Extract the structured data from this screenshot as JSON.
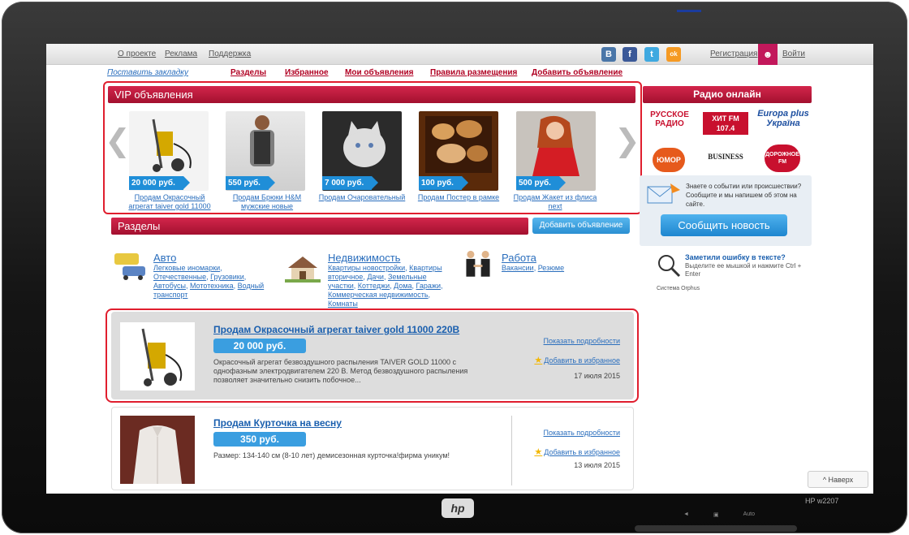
{
  "topbar": {
    "links": [
      "О проекте",
      "Реклама",
      "Поддержка"
    ],
    "social": [
      "В",
      "f",
      "t",
      "ok"
    ],
    "register": "Регистрация",
    "login": "Войти"
  },
  "nav": {
    "bookmark": "Поставить закладку",
    "links": [
      "Разделы",
      "Избранное",
      "Мои объявления",
      "Правила размещения",
      "Добавить объявление"
    ]
  },
  "vip": {
    "title": "VIP объявления",
    "items": [
      {
        "price": "20 000 руб.",
        "title": "Продам Окрасочный агрегат taiver gold 11000"
      },
      {
        "price": "550 руб.",
        "title": "Продам Брюки H&M мужские новые"
      },
      {
        "price": "7 000 руб.",
        "title": "Продам Очаровательный"
      },
      {
        "price": "100 руб.",
        "title": "Продам Постер в рамке"
      },
      {
        "price": "500 руб.",
        "title": "Продам Жакет из флиса next"
      }
    ]
  },
  "sections": {
    "title": "Разделы",
    "add_button": "Добавить объявление",
    "categories": [
      {
        "title": "Авто",
        "links": [
          "Легковые иномарки",
          "Отечественные",
          "Грузовики",
          "Автобусы",
          "Мототехника",
          "Водный транспорт"
        ]
      },
      {
        "title": "Недвижимость",
        "links": [
          "Квартиры новостройки",
          "Квартиры вторичное",
          "Дачи",
          "Земельные участки",
          "Коттеджи",
          "Дома",
          "Гаражи",
          "Коммерческая недвижимость",
          "Комнаты"
        ]
      },
      {
        "title": "Работа",
        "links": [
          "Вакансии",
          "Резюме"
        ]
      }
    ]
  },
  "listings": [
    {
      "title": "Продам Окрасочный агрегат taiver gold 11000 220В",
      "price": "20 000 руб.",
      "description": "Окрасочный агрегат безвоздушного распыления TAIVER GOLD 11000 с однофазным электродвигателем 220 В. Метод безвоздушного распыления позволяет значительно снизить побочное...",
      "more": "Показать подробности",
      "favorite": "Добавить в избранное",
      "date": "17 июля 2015"
    },
    {
      "title": "Продам Курточка на весну",
      "price": "350 руб.",
      "description": "Размер: 134-140 см (8-10 лет) демисезонная курточка!фирма уникум!",
      "more": "Показать подробности",
      "favorite": "Добавить в избранное",
      "date": "13 июля 2015"
    }
  ],
  "radio": {
    "title": "Радио онлайн",
    "stations": [
      "РУССКОЕ РАДИО",
      "ХИТ FM 107.4",
      "Europa plus Україна",
      "ЮМОР FM",
      "BUSINESS",
      "ДОРОЖНОЕ FM"
    ]
  },
  "news": {
    "text": "Знаете о событии или происшествии? Сообщите и мы напишем об этом на сайте.",
    "button": "Сообщить новость"
  },
  "error": {
    "title": "Заметили ошибку в тексте?",
    "text": "Выделите ее мышкой и нажмите Ctrl + Enter",
    "system": "Система Orphus"
  },
  "up_button": "^ Наверх",
  "monitor": {
    "brand": "hp",
    "model": "HP w2207",
    "controls": [
      "◄",
      "▣",
      "Auto"
    ]
  }
}
